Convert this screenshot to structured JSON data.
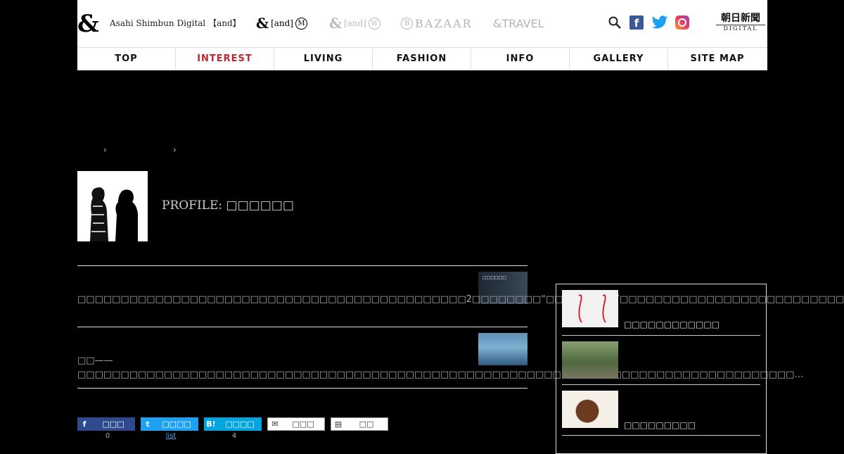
{
  "header": {
    "logo_symbol": "&",
    "logo_text": "Asahi Shimbun Digital 【and】",
    "brands": [
      {
        "amp": "&",
        "bracket": "[and]",
        "mark": "M"
      },
      {
        "amp": "&",
        "bracket": "[and]",
        "mark": "W"
      },
      {
        "mark": "B",
        "label": "BAZAAR"
      },
      {
        "label": "&TRAVEL"
      }
    ],
    "social": {
      "facebook": "f"
    },
    "asahi": {
      "jp": "朝日新聞",
      "digital": "DIGITAL"
    }
  },
  "nav": [
    "TOP",
    "INTEREST",
    "LIVING",
    "FASHION",
    "INFO",
    "GALLERY",
    "SITE MAP"
  ],
  "nav_active": "INTEREST",
  "breadcrumb": {
    "sep": "›"
  },
  "profile": {
    "label": "PROFILE:",
    "name": "□□□□□□"
  },
  "articles": [
    {
      "excerpt": "□□□□□□□□□□□□□□□□□□□□□□□□□□□□□□□□□□□□□□□□□□□□□2□□□□□□□□“□□□□□□□□”□□□□□□□□□□□□□□□□□□□□□□□□□□□□□…",
      "thumb_text": "□□□□□□"
    },
    {
      "excerpt": "□□——□□□□□□□□□□□□□□□□□□□□□□□□□□□□□□□□□□□□□□□□□□□□□□□□□□□□□□□□□□□□□□□□□□□□□□□□□□□□□□□□□□□…"
    }
  ],
  "sidebar": [
    {
      "title": "□□□□□□□□□□□□"
    },
    {
      "title": ""
    },
    {
      "title": "□□□□□□□□□"
    }
  ],
  "share": {
    "buttons": [
      {
        "icon": "f",
        "label": "□□□",
        "count": "0"
      },
      {
        "icon": "t",
        "label": "□□□□",
        "count": "list"
      },
      {
        "icon": "B!",
        "label": "□□□□",
        "count": "4"
      },
      {
        "icon": "✉",
        "label": "□□□"
      },
      {
        "icon": "▤",
        "label": "□□"
      }
    ]
  },
  "colors": {
    "accent": "#c0272d",
    "facebook": "#3b5998",
    "twitter": "#1da1f2",
    "hatena": "#00a4de",
    "share_bg": "#2e4a8c"
  }
}
